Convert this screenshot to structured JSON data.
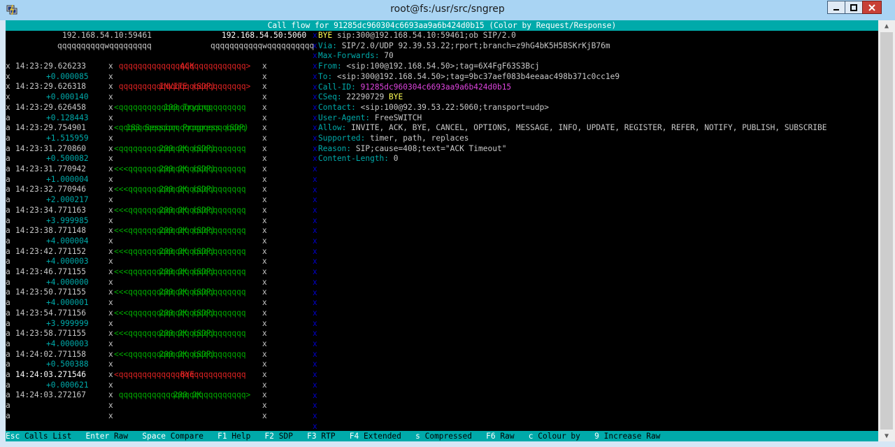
{
  "window": {
    "title": "root@fs:/usr/src/sngrep"
  },
  "header": "Call flow for 91285dc960304c6693aa9a6b424d0b15 (Color by Request/Response)",
  "hosts": [
    "192.168.54.10:59461",
    "192.168.54.50:5060"
  ],
  "host_lines": [
    "qqqqqqqqqqwqqqqqqqqq",
    "qqqqqqqqqqqwqqqqqqqqqq"
  ],
  "flow": [
    {
      "lead": "x",
      "time": "14:23:29.626233",
      "label": "ACK",
      "lc": "r",
      "arrow": " qqqqqqqqqqqqqqqqqqqqqqqqqqq> ",
      "ac": "r",
      "tail": "x",
      "hl": true
    },
    {
      "lead": "x",
      "time": "+0.000085",
      "label": "",
      "lc": "r",
      "arrow": "",
      "ac": "r",
      "tail": "x",
      "delta": true
    },
    {
      "lead": "x",
      "time": "14:23:29.626318",
      "label": "INVITE (SDP)",
      "lc": "r",
      "arrow": " qqqqqqqqqqqqqqqqqqqqqqqqqqq> ",
      "ac": "r",
      "tail": "x"
    },
    {
      "lead": "x",
      "time": "+0.000140",
      "label": "",
      "lc": "r",
      "arrow": "",
      "ac": "r",
      "tail": "x",
      "delta": true
    },
    {
      "lead": "x",
      "time": "14:23:29.626458",
      "label": "100 Trying",
      "lc": "g",
      "arrow": "<qqqqqqqqqqqqqqqqqqqqqqqqqqq  ",
      "ac": "g",
      "tail": "x"
    },
    {
      "lead": "a",
      "time": "+0.128443",
      "label": "",
      "lc": "g",
      "arrow": "",
      "ac": "g",
      "tail": "x",
      "delta": true
    },
    {
      "lead": "a",
      "time": "14:23:29.754901",
      "label": "183 Session Progress (SDP)",
      "lc": "g",
      "arrow": "<qqqqqqqqqqqqqqqqqqqqqqqqqqq  ",
      "ac": "g",
      "tail": "x"
    },
    {
      "lead": "a",
      "time": "+1.515959",
      "label": "",
      "lc": "g",
      "arrow": "",
      "ac": "g",
      "tail": "x",
      "delta": true
    },
    {
      "lead": "a",
      "time": "14:23:31.270860",
      "label": "200 OK (SDP)",
      "lc": "g",
      "arrow": "<qqqqqqqqqqqqqqqqqqqqqqqqqqq  ",
      "ac": "g",
      "tail": "x"
    },
    {
      "lead": "a",
      "time": "+0.500082",
      "label": "",
      "lc": "g",
      "arrow": "",
      "ac": "g",
      "tail": "x",
      "delta": true
    },
    {
      "lead": "a",
      "time": "14:23:31.770942",
      "label": "200 OK (SDP)",
      "lc": "g",
      "arrow": "<<<qqqqqqqqqqqqqqqqqqqqqqqqq  ",
      "ac": "g",
      "tail": "x"
    },
    {
      "lead": "a",
      "time": "+1.000004",
      "label": "",
      "lc": "g",
      "arrow": "",
      "ac": "g",
      "tail": "x",
      "delta": true
    },
    {
      "lead": "a",
      "time": "14:23:32.770946",
      "label": "200 OK (SDP)",
      "lc": "g",
      "arrow": "<<<qqqqqqqqqqqqqqqqqqqqqqqqq  ",
      "ac": "g",
      "tail": "x"
    },
    {
      "lead": "a",
      "time": "+2.000217",
      "label": "",
      "lc": "g",
      "arrow": "",
      "ac": "g",
      "tail": "x",
      "delta": true
    },
    {
      "lead": "a",
      "time": "14:23:34.771163",
      "label": "200 OK (SDP)",
      "lc": "g",
      "arrow": "<<<qqqqqqqqqqqqqqqqqqqqqqqqq  ",
      "ac": "g",
      "tail": "x"
    },
    {
      "lead": "a",
      "time": "+3.999985",
      "label": "",
      "lc": "g",
      "arrow": "",
      "ac": "g",
      "tail": "x",
      "delta": true
    },
    {
      "lead": "a",
      "time": "14:23:38.771148",
      "label": "200 OK (SDP)",
      "lc": "g",
      "arrow": "<<<qqqqqqqqqqqqqqqqqqqqqqqqq  ",
      "ac": "g",
      "tail": "x"
    },
    {
      "lead": "a",
      "time": "+4.000004",
      "label": "",
      "lc": "g",
      "arrow": "",
      "ac": "g",
      "tail": "x",
      "delta": true
    },
    {
      "lead": "a",
      "time": "14:23:42.771152",
      "label": "200 OK (SDP)",
      "lc": "g",
      "arrow": "<<<qqqqqqqqqqqqqqqqqqqqqqqqq  ",
      "ac": "g",
      "tail": "x"
    },
    {
      "lead": "a",
      "time": "+4.000003",
      "label": "",
      "lc": "g",
      "arrow": "",
      "ac": "g",
      "tail": "x",
      "delta": true
    },
    {
      "lead": "a",
      "time": "14:23:46.771155",
      "label": "200 OK (SDP)",
      "lc": "g",
      "arrow": "<<<qqqqqqqqqqqqqqqqqqqqqqqqq  ",
      "ac": "g",
      "tail": "x"
    },
    {
      "lead": "a",
      "time": "+4.000000",
      "label": "",
      "lc": "g",
      "arrow": "",
      "ac": "g",
      "tail": "x",
      "delta": true
    },
    {
      "lead": "a",
      "time": "14:23:50.771155",
      "label": "200 OK (SDP)",
      "lc": "g",
      "arrow": "<<<qqqqqqqqqqqqqqqqqqqqqqqqq  ",
      "ac": "g",
      "tail": "x"
    },
    {
      "lead": "a",
      "time": "+4.000001",
      "label": "",
      "lc": "g",
      "arrow": "",
      "ac": "g",
      "tail": "x",
      "delta": true
    },
    {
      "lead": "a",
      "time": "14:23:54.771156",
      "label": "200 OK (SDP)",
      "lc": "g",
      "arrow": "<<<qqqqqqqqqqqqqqqqqqqqqqqqq  ",
      "ac": "g",
      "tail": "x"
    },
    {
      "lead": "a",
      "time": "+3.999999",
      "label": "",
      "lc": "g",
      "arrow": "",
      "ac": "g",
      "tail": "x",
      "delta": true
    },
    {
      "lead": "a",
      "time": "14:23:58.771155",
      "label": "200 OK (SDP)",
      "lc": "g",
      "arrow": "<<<qqqqqqqqqqqqqqqqqqqqqqqqq  ",
      "ac": "g",
      "tail": "x"
    },
    {
      "lead": "a",
      "time": "+4.000003",
      "label": "",
      "lc": "g",
      "arrow": "",
      "ac": "g",
      "tail": "x",
      "delta": true
    },
    {
      "lead": "a",
      "time": "14:24:02.771158",
      "label": "200 OK (SDP)",
      "lc": "g",
      "arrow": "<<<qqqqqqqqqqqqqqqqqqqqqqqqq  ",
      "ac": "g",
      "tail": "x"
    },
    {
      "lead": "a",
      "time": "+0.500388",
      "label": "",
      "lc": "g",
      "arrow": "",
      "ac": "g",
      "tail": "x",
      "delta": true
    },
    {
      "lead": "a",
      "time": "14:24:03.271546",
      "label": "BYE",
      "lc": "r",
      "arrow": "<qqqqqqqqqqqqqqqqqqqqqqqqqqq  ",
      "ac": "r",
      "tail": "x",
      "bold": true
    },
    {
      "lead": "a",
      "time": "+0.000621",
      "label": "",
      "lc": "r",
      "arrow": "",
      "ac": "r",
      "tail": "x",
      "delta": true
    },
    {
      "lead": "a",
      "time": "14:24:03.272167",
      "label": "200 OK",
      "lc": "g",
      "arrow": " qqqqqqqqqqqqqqqqqqqqqqqqqqq> ",
      "ac": "g",
      "tail": "x"
    },
    {
      "lead": "a",
      "time": "",
      "label": "",
      "lc": "g",
      "arrow": "",
      "ac": "g",
      "tail": "x"
    },
    {
      "lead": "a",
      "time": "",
      "label": "",
      "lc": "g",
      "arrow": "",
      "ac": "g",
      "tail": "x"
    }
  ],
  "raw": [
    [
      [
        "y",
        "BYE "
      ],
      [
        "w",
        "sip:300@192.168.54.10:59461;ob SIP/2.0"
      ]
    ],
    [
      [
        "c",
        "Via: "
      ],
      [
        "w",
        "SIP/2.0/UDP 92.39.53.22;rport;branch=z9hG4bK5H5BSKrKjB76m"
      ]
    ],
    [
      [
        "c",
        "Max-Forwards: "
      ],
      [
        "w",
        "70"
      ]
    ],
    [
      [
        "c",
        "From: "
      ],
      [
        "w",
        "<sip:100@192.168.54.50>;tag=6X4FgF63S3Bcj"
      ]
    ],
    [
      [
        "c",
        "To: "
      ],
      [
        "w",
        "<sip:300@192.168.54.50>;tag=9bc37aef083b4eeaac498b371c0cc1e9"
      ]
    ],
    [
      [
        "c",
        "Call-ID: "
      ],
      [
        "m",
        "91285dc960304c6693aa9a6b424d0b15"
      ]
    ],
    [
      [
        "c",
        "CSeq: "
      ],
      [
        "w",
        "22290729 "
      ],
      [
        "y",
        "BYE"
      ]
    ],
    [
      [
        "c",
        "Contact: "
      ],
      [
        "w",
        "<sip:100@92.39.53.22:5060;transport=udp>"
      ]
    ],
    [
      [
        "c",
        "User-Agent: "
      ],
      [
        "w",
        "FreeSWITCH"
      ]
    ],
    [
      [
        "c",
        "Allow: "
      ],
      [
        "w",
        "INVITE, ACK, BYE, CANCEL, OPTIONS, MESSAGE, INFO, UPDATE, REGISTER, REFER, NOTIFY, PUBLISH, SUBSCRIBE"
      ]
    ],
    [
      [
        "c",
        "Supported: "
      ],
      [
        "w",
        "timer, path, replaces"
      ]
    ],
    [
      [
        "c",
        "Reason: "
      ],
      [
        "w",
        "SIP;cause=408;text=\"ACK Timeout\""
      ]
    ],
    [
      [
        "c",
        "Content-Length: "
      ],
      [
        "w",
        "0"
      ]
    ]
  ],
  "footer": [
    {
      "key": "Esc",
      "desc": "Calls List"
    },
    {
      "key": "Enter",
      "desc": "Raw"
    },
    {
      "key": "Space",
      "desc": "Compare"
    },
    {
      "key": "F1",
      "desc": "Help"
    },
    {
      "key": "F2",
      "desc": "SDP"
    },
    {
      "key": "F3",
      "desc": "RTP"
    },
    {
      "key": "F4",
      "desc": "Extended"
    },
    {
      "key": "s",
      "desc": "Compressed"
    },
    {
      "key": "F6",
      "desc": "Raw"
    },
    {
      "key": "c",
      "desc": "Colour by"
    },
    {
      "key": "9",
      "desc": "Increase Raw"
    }
  ],
  "colors": {
    "header_bg": "#00aaaa",
    "request": "#dd2222",
    "response": "#00aa00",
    "delta": "#00aaaa",
    "method": "#ffff55",
    "callid": "#dd44dd"
  }
}
